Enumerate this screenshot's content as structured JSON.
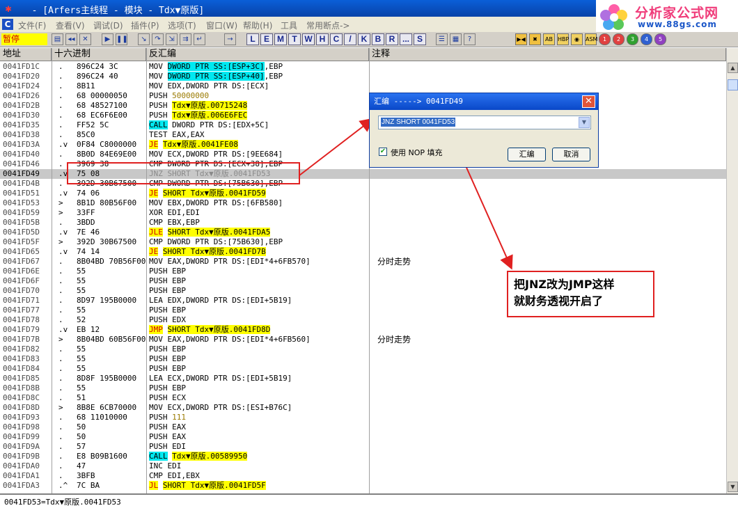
{
  "window": {
    "title": "  - [Arfers主线程 - 模块 - Tdx▼原版]"
  },
  "brand": {
    "name": "分析家公式网",
    "url": "www.88gs.com"
  },
  "menu": [
    "文件(F)",
    "查看(V)",
    "调试(D)",
    "插件(P)",
    "选项(T)",
    "窗口(W)",
    "帮助(H)",
    "工具",
    "常用断点->"
  ],
  "toolbar": {
    "status_label": "暂停",
    "letter_buttons": [
      "L",
      "E",
      "M",
      "T",
      "W",
      "H",
      "C",
      "/",
      "K",
      "B",
      "R",
      "...",
      "S"
    ]
  },
  "columns": {
    "address": "地址",
    "hex": "十六进制",
    "disasm": "反汇编",
    "comment": "注释"
  },
  "rows": [
    {
      "addr": "0041FD1C",
      "mark": ".",
      "hex": "896C24 3C",
      "mn": "MOV",
      "ops": [
        {
          "t": "DWORD PTR SS:[ESP+3C]",
          "hl": "c"
        },
        {
          "t": ",EBP"
        }
      ]
    },
    {
      "addr": "0041FD20",
      "mark": ".",
      "hex": "896C24 40",
      "mn": "MOV",
      "ops": [
        {
          "t": "DWORD PTR SS:[ESP+40]",
          "hl": "c"
        },
        {
          "t": ",EBP"
        }
      ]
    },
    {
      "addr": "0041FD24",
      "mark": ".",
      "hex": "8B11",
      "mn": "MOV",
      "ops": [
        {
          "t": "EDX,DWORD PTR DS:[ECX]"
        }
      ]
    },
    {
      "addr": "0041FD26",
      "mark": ".",
      "hex": "68 00000050",
      "mn": "PUSH",
      "ops": [
        {
          "t": "50000000",
          "num": true
        }
      ]
    },
    {
      "addr": "0041FD2B",
      "mark": ".",
      "hex": "68 48527100",
      "mn": "PUSH",
      "ops": [
        {
          "t": "Tdx▼原版.00715248",
          "hl": "y"
        }
      ]
    },
    {
      "addr": "0041FD30",
      "mark": ".",
      "hex": "68 EC6F6E00",
      "mn": "PUSH",
      "ops": [
        {
          "t": "Tdx▼原版.006E6FEC",
          "hl": "y"
        }
      ]
    },
    {
      "addr": "0041FD35",
      "mark": ".",
      "hex": "FF52 5C",
      "mn": "CALL",
      "mnhl": "c",
      "ops": [
        {
          "t": "DWORD PTR DS:[EDX+5C]"
        }
      ]
    },
    {
      "addr": "0041FD38",
      "mark": ".",
      "hex": "85C0",
      "mn": "TEST",
      "ops": [
        {
          "t": "EAX,EAX"
        }
      ]
    },
    {
      "addr": "0041FD3A",
      "mark": ".v",
      "hex": "0F84 C8000000",
      "mn": "JE",
      "mnhl": "yr",
      "ops": [
        {
          "t": "Tdx▼原版.0041FE08",
          "hl": "y"
        }
      ]
    },
    {
      "addr": "0041FD40",
      "mark": ".",
      "hex": "8B0D 84E69E00",
      "mn": "MOV",
      "ops": [
        {
          "t": "ECX,DWORD PTR DS:[9EE684]"
        }
      ]
    },
    {
      "addr": "0041FD46",
      "mark": ".",
      "hex": "3969 38",
      "mn": "CMP",
      "ops": [
        {
          "t": "DWORD PTR DS:[ECX+38],EBP"
        }
      ]
    },
    {
      "addr": "0041FD49",
      "mark": ".v",
      "hex": "75 08",
      "mn": "JNZ",
      "ops": [
        {
          "t": "SHORT Tdx▼原版.0041FD53"
        }
      ],
      "sel": true
    },
    {
      "addr": "0041FD4B",
      "mark": ".",
      "hex": "392D 30B67500",
      "mn": "CMP",
      "ops": [
        {
          "t": "DWORD PTR DS:[75B630],EBP"
        }
      ]
    },
    {
      "addr": "0041FD51",
      "mark": ".v",
      "hex": "74 06",
      "mn": "JE",
      "mnhl": "yr",
      "ops": [
        {
          "t": "SHORT Tdx▼原版.0041FD59",
          "hl": "y"
        }
      ]
    },
    {
      "addr": "0041FD53",
      "mark": ">",
      "hex": "8B1D 80B56F00",
      "mn": "MOV",
      "ops": [
        {
          "t": "EBX,DWORD PTR DS:[6FB580]"
        }
      ]
    },
    {
      "addr": "0041FD59",
      "mark": ">",
      "hex": "33FF",
      "mn": "XOR",
      "ops": [
        {
          "t": "EDI,EDI"
        }
      ]
    },
    {
      "addr": "0041FD5B",
      "mark": ".",
      "hex": "3BDD",
      "mn": "CMP",
      "ops": [
        {
          "t": "EBX,EBP"
        }
      ]
    },
    {
      "addr": "0041FD5D",
      "mark": ".v",
      "hex": "7E 46",
      "mn": "JLE",
      "mnhl": "yr",
      "ops": [
        {
          "t": "SHORT Tdx▼原版.0041FDA5",
          "hl": "y"
        }
      ]
    },
    {
      "addr": "0041FD5F",
      "mark": ">",
      "hex": "392D 30B67500",
      "mn": "CMP",
      "ops": [
        {
          "t": "DWORD PTR DS:[75B630],EBP"
        }
      ]
    },
    {
      "addr": "0041FD65",
      "mark": ".v",
      "hex": "74 14",
      "mn": "JE",
      "mnhl": "yr",
      "ops": [
        {
          "t": "SHORT Tdx▼原版.0041FD7B",
          "hl": "y"
        }
      ]
    },
    {
      "addr": "0041FD67",
      "mark": ".",
      "hex": "8B04BD 70B56F00",
      "mn": "MOV",
      "ops": [
        {
          "t": "EAX,DWORD PTR DS:[EDI*4+6FB570]"
        }
      ],
      "comment": "分时走势"
    },
    {
      "addr": "0041FD6E",
      "mark": ".",
      "hex": "55",
      "mn": "PUSH",
      "ops": [
        {
          "t": "EBP"
        }
      ]
    },
    {
      "addr": "0041FD6F",
      "mark": ".",
      "hex": "55",
      "mn": "PUSH",
      "ops": [
        {
          "t": "EBP"
        }
      ]
    },
    {
      "addr": "0041FD70",
      "mark": ".",
      "hex": "55",
      "mn": "PUSH",
      "ops": [
        {
          "t": "EBP"
        }
      ]
    },
    {
      "addr": "0041FD71",
      "mark": ".",
      "hex": "8D97 195B0000",
      "mn": "LEA",
      "ops": [
        {
          "t": "EDX,DWORD PTR DS:[EDI+5B19]"
        }
      ]
    },
    {
      "addr": "0041FD77",
      "mark": ".",
      "hex": "55",
      "mn": "PUSH",
      "ops": [
        {
          "t": "EBP"
        }
      ]
    },
    {
      "addr": "0041FD78",
      "mark": ".",
      "hex": "52",
      "mn": "PUSH",
      "ops": [
        {
          "t": "EDX"
        }
      ]
    },
    {
      "addr": "0041FD79",
      "mark": ".v",
      "hex": "EB 12",
      "mn": "JMP",
      "mnhl": "yr",
      "ops": [
        {
          "t": "SHORT Tdx▼原版.0041FD8D",
          "hl": "y"
        }
      ]
    },
    {
      "addr": "0041FD7B",
      "mark": ">",
      "hex": "8B04BD 60B56F00",
      "mn": "MOV",
      "ops": [
        {
          "t": "EAX,DWORD PTR DS:[EDI*4+6FB560]"
        }
      ],
      "comment": "分时走势"
    },
    {
      "addr": "0041FD82",
      "mark": ".",
      "hex": "55",
      "mn": "PUSH",
      "ops": [
        {
          "t": "EBP"
        }
      ]
    },
    {
      "addr": "0041FD83",
      "mark": ".",
      "hex": "55",
      "mn": "PUSH",
      "ops": [
        {
          "t": "EBP"
        }
      ]
    },
    {
      "addr": "0041FD84",
      "mark": ".",
      "hex": "55",
      "mn": "PUSH",
      "ops": [
        {
          "t": "EBP"
        }
      ]
    },
    {
      "addr": "0041FD85",
      "mark": ".",
      "hex": "8D8F 195B0000",
      "mn": "LEA",
      "ops": [
        {
          "t": "ECX,DWORD PTR DS:[EDI+5B19]"
        }
      ]
    },
    {
      "addr": "0041FD8B",
      "mark": ".",
      "hex": "55",
      "mn": "PUSH",
      "ops": [
        {
          "t": "EBP"
        }
      ]
    },
    {
      "addr": "0041FD8C",
      "mark": ".",
      "hex": "51",
      "mn": "PUSH",
      "ops": [
        {
          "t": "ECX"
        }
      ]
    },
    {
      "addr": "0041FD8D",
      "mark": ">",
      "hex": "8B8E 6CB70000",
      "mn": "MOV",
      "ops": [
        {
          "t": "ECX,DWORD PTR DS:[ESI+B76C]"
        }
      ]
    },
    {
      "addr": "0041FD93",
      "mark": ".",
      "hex": "68 11010000",
      "mn": "PUSH",
      "ops": [
        {
          "t": "111",
          "num": true
        }
      ]
    },
    {
      "addr": "0041FD98",
      "mark": ".",
      "hex": "50",
      "mn": "PUSH",
      "ops": [
        {
          "t": "EAX"
        }
      ]
    },
    {
      "addr": "0041FD99",
      "mark": ".",
      "hex": "50",
      "mn": "PUSH",
      "ops": [
        {
          "t": "EAX"
        }
      ]
    },
    {
      "addr": "0041FD9A",
      "mark": ".",
      "hex": "57",
      "mn": "PUSH",
      "ops": [
        {
          "t": "EDI"
        }
      ]
    },
    {
      "addr": "0041FD9B",
      "mark": ".",
      "hex": "E8 B09B1600",
      "mn": "CALL",
      "mnhl": "c",
      "ops": [
        {
          "t": "Tdx▼原版.00589950",
          "hl": "y"
        }
      ]
    },
    {
      "addr": "0041FDA0",
      "mark": ".",
      "hex": "47",
      "mn": "INC",
      "ops": [
        {
          "t": "EDI"
        }
      ]
    },
    {
      "addr": "0041FDA1",
      "mark": ".",
      "hex": "3BFB",
      "mn": "CMP",
      "ops": [
        {
          "t": "EDI,EBX"
        }
      ]
    },
    {
      "addr": "0041FDA3",
      "mark": ".^",
      "hex": "7C BA",
      "mn": "JL",
      "mnhl": "yr",
      "ops": [
        {
          "t": "SHORT Tdx▼原版.0041FD5F",
          "hl": "y"
        }
      ]
    }
  ],
  "info_line": "0041FD53=Tdx▼原版.0041FD53",
  "dialog": {
    "title": "汇编 -----> 0041FD49",
    "input_value": "JNZ SHORT 0041FD53",
    "checkbox_label": "使用 NOP 填充",
    "assemble_button": "汇编",
    "cancel_button": "取消"
  },
  "annotation": {
    "line1": "把JNZ改为JMP这样",
    "line2": "就财务透视开启了"
  },
  "colors": {
    "highlight_yellow": "#ffff00",
    "highlight_cyan": "#00e8f0",
    "annotation_red": "#e02020",
    "selection_gray": "#c8c8c8"
  }
}
